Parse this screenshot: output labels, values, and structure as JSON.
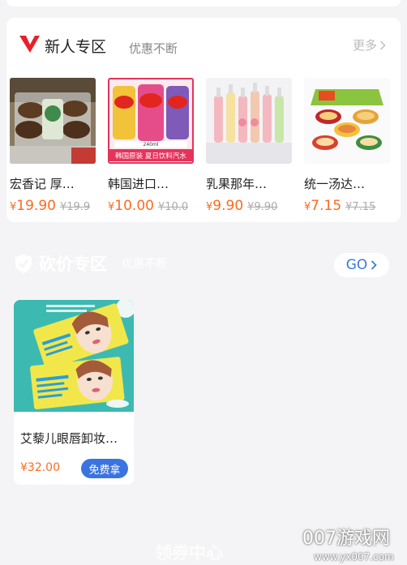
{
  "newbie_section": {
    "title": "新人专区",
    "subtitle": "优惠不断",
    "more_label": "更多"
  },
  "products": [
    {
      "name": "宏香记 厚…",
      "price": "19.90",
      "original_price": "¥19.9",
      "currency": "¥"
    },
    {
      "name": "韩国进口…",
      "price": "10.00",
      "original_price": "¥10.0",
      "currency": "¥",
      "image_caption": "韩国原装 夏日饮料汽水",
      "image_badge": "240ml"
    },
    {
      "name": "乳果那年…",
      "price": "9.90",
      "original_price": "¥9.90",
      "currency": "¥"
    },
    {
      "name": "统一汤达…",
      "price": "7.15",
      "original_price": "¥7.15",
      "currency": "¥"
    }
  ],
  "bargain_section": {
    "title": "砍价专区",
    "subtitle": "优惠不断",
    "go_label": "GO"
  },
  "bargain_item": {
    "name": "艾藜儿眼唇卸妆…",
    "price": "¥32.00",
    "button_label": "免费拿"
  },
  "footer": {
    "center_label": "领券中心"
  },
  "watermark": {
    "brand": "007游戏网",
    "url": "www.yx007.com"
  },
  "colors": {
    "accent_orange": "#ff6a1f",
    "brand_red": "#e8202a",
    "button_blue": "#3a74e0",
    "page_bg": "#f4f4f6"
  }
}
